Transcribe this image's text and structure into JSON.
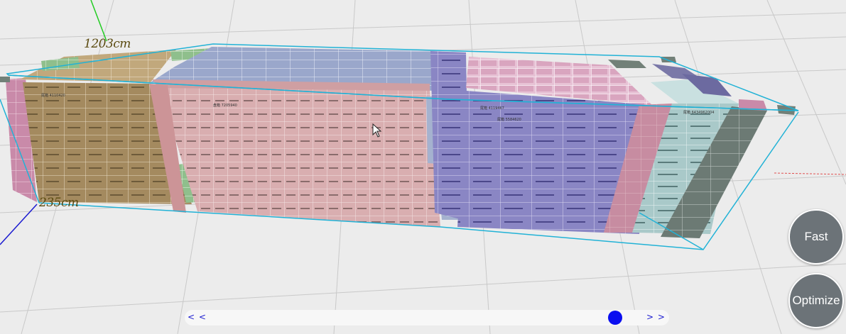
{
  "view": {
    "length_label": "1203cm",
    "width_label": "235cm"
  },
  "controls": {
    "fast_label": "Fast",
    "optimize_label": "Optimize"
  },
  "timeline": {
    "prev_label": "< <",
    "next_label": "> >",
    "position": 0.94
  },
  "box_labels": {
    "tan": "尾箱 4110420",
    "pink": "盘箱 7205940",
    "purple": "尾箱 5584620",
    "mauve": "尾箱 4119467",
    "teal": "尾箱 6434962004"
  },
  "colors": {
    "tan": "#a48a5f",
    "pink": "#d9aeb0",
    "purple": "#8a86c4",
    "mauve": "#c98aa9",
    "teal": "#a9c9c9",
    "green": "#8fbf8c",
    "slate": "#6c7a74",
    "container_edge": "#21b2d6",
    "slider_thumb": "#0b0ff0"
  }
}
